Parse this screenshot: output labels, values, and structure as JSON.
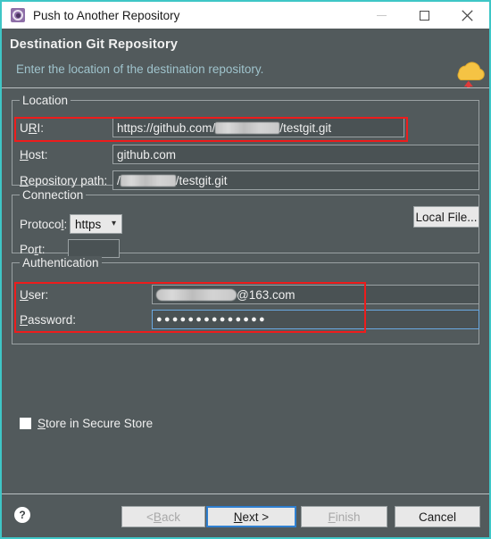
{
  "window": {
    "title": "Push to Another Repository",
    "icon": "eclipse-gear-icon",
    "minimize_label": "Minimize",
    "maximize_label": "Maximize",
    "close_label": "Close",
    "accent_border": "#3ec6c6",
    "background": "#525a5c"
  },
  "header": {
    "title": "Destination Git Repository",
    "subtitle": "Enter the location of the destination repository.",
    "icon": "cloud-upload-icon",
    "title_color": "#f2f2f2",
    "subtitle_color": "#9fc3cc"
  },
  "location": {
    "legend": "Location",
    "uri": {
      "label_pre": "U",
      "label_mnemonic": "R",
      "label_post": "I:",
      "label": "URI:",
      "value_prefix": "https://github.com/",
      "value_redacted": true,
      "value_suffix": "/testgit.git",
      "full_value": "https://github.com/███████/testgit.git"
    },
    "host": {
      "label_mnemonic": "H",
      "label_post": "ost:",
      "label": "Host:",
      "value": "github.com"
    },
    "repo_path": {
      "label_mnemonic": "R",
      "label_post": "epository path:",
      "label": "Repository path:",
      "value_prefix": "/",
      "value_redacted": true,
      "value_suffix": "/testgit.git",
      "full_value": "/███████/testgit.git"
    },
    "local_file_button": "Local File..."
  },
  "connection": {
    "legend": "Connection",
    "protocol": {
      "label_pre": "Protoco",
      "label_mnemonic": "l",
      "label_post": ":",
      "label": "Protocol:",
      "value": "https",
      "chevron": "chevron-down-icon"
    },
    "port": {
      "label_pre": "Po",
      "label_mnemonic": "r",
      "label_post": "t:",
      "label": "Port:",
      "value": ""
    }
  },
  "authentication": {
    "legend": "Authentication",
    "user": {
      "label_mnemonic": "U",
      "label_post": "ser:",
      "label": "User:",
      "value_redacted": true,
      "value_suffix": "@163.com",
      "full_value": "████████@163.com"
    },
    "password": {
      "label_mnemonic": "P",
      "label_post": "assword:",
      "label": "Password:",
      "masked_value": "●●●●●●●●●●●●●●",
      "char_count": 14,
      "focused": true,
      "focus_color": "#6aa8e0"
    },
    "store_checkbox": {
      "label_mnemonic": "S",
      "label_post": "tore in Secure Store",
      "label": "Store in Secure Store",
      "checked": false
    }
  },
  "annotations": {
    "color": "#ee1c1c",
    "boxes": [
      "uri-field-highlight",
      "authentication-fields-highlight"
    ]
  },
  "footer": {
    "help_icon": "help-icon",
    "help_glyph": "?",
    "back": {
      "label_pre": "< ",
      "label_mnemonic": "B",
      "label_post": "ack",
      "label": "< Back",
      "enabled": false
    },
    "next": {
      "label_mnemonic": "N",
      "label_post": "ext >",
      "label": "Next >",
      "enabled": true,
      "default": true
    },
    "finish": {
      "label_mnemonic": "F",
      "label_post": "inish",
      "label": "Finish",
      "enabled": false
    },
    "cancel": {
      "label": "Cancel",
      "enabled": true
    }
  }
}
